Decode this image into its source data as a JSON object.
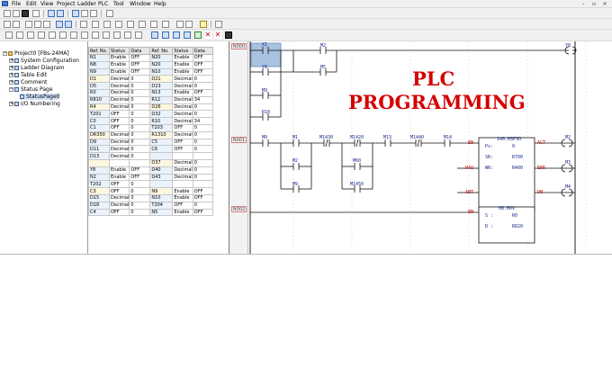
{
  "menu": {
    "items": [
      "File",
      "Edit",
      "View",
      "Project",
      "Ladder",
      "PLC",
      "Tool",
      "Window",
      "Help"
    ],
    "window_buttons": [
      "–",
      "▫",
      "×"
    ]
  },
  "tree": {
    "items": [
      {
        "label": "Project0 [FBs-24MA]",
        "level": 0,
        "expander": "−"
      },
      {
        "label": "System Configuration",
        "level": 1,
        "expander": "+"
      },
      {
        "label": "Ladder Diagram",
        "level": 1,
        "expander": "+"
      },
      {
        "label": "Table Edit",
        "level": 1,
        "expander": "+"
      },
      {
        "label": "Comment",
        "level": 1,
        "expander": "+"
      },
      {
        "label": "Status Page",
        "level": 1,
        "expander": "−"
      },
      {
        "label": "StatusPage0",
        "level": 2,
        "expander": ""
      },
      {
        "label": "I/O Numbering",
        "level": 1,
        "expander": "+"
      }
    ]
  },
  "status_table": {
    "headers": [
      "Ref. No.",
      "Status",
      "Data",
      "Ref. No.",
      "Status",
      "Data"
    ],
    "rows": [
      [
        "N1",
        "Enable",
        "OFF",
        "N20",
        "Enable",
        "OFF"
      ],
      [
        "N8",
        "Enable",
        "OFF",
        "N20",
        "Enable",
        "OFF"
      ],
      [
        "N9",
        "Enable",
        "OFF",
        "N10",
        "Enable",
        "OFF"
      ],
      [
        "D1",
        "Decimal",
        "0",
        "D21",
        "Decimal",
        "0"
      ],
      [
        "D5",
        "Decimal",
        "0",
        "D23",
        "Decimal",
        "0"
      ],
      [
        "R0",
        "Decimal",
        "0",
        "N13",
        "Enable",
        "OFF"
      ],
      [
        "R810",
        "Decimal",
        "0",
        "R12",
        "Decimal",
        "34"
      ],
      [
        "R4",
        "Decimal",
        "0",
        "D26",
        "Decimal",
        "0"
      ],
      [
        "T201",
        "OFF",
        "0",
        "D32",
        "Decimal",
        "0"
      ],
      [
        "C0",
        "OFF",
        "0",
        "R10",
        "Decimal",
        "34"
      ],
      [
        "C1",
        "OFF",
        "0",
        "T203",
        "OFF",
        "0"
      ],
      [
        "DR350",
        "Decimal",
        "0",
        "R1310",
        "Decimal",
        "0"
      ],
      [
        "D9",
        "Decimal",
        "0",
        "C5",
        "OFF",
        "0"
      ],
      [
        "D11",
        "Decimal",
        "0",
        "C6",
        "OFF",
        "0"
      ],
      [
        "D13",
        "Decimal",
        "0",
        "",
        "",
        ""
      ],
      [
        "",
        "",
        "",
        "D37",
        "Decimal",
        "0"
      ],
      [
        "Y8",
        "Enable",
        "OFF",
        "D40",
        "Decimal",
        "0"
      ],
      [
        "N2",
        "Enable",
        "OFF",
        "D43",
        "Decimal",
        "0"
      ],
      [
        "T202",
        "OFF",
        "0",
        "",
        "",
        ""
      ],
      [
        "C3",
        "OFF",
        "0",
        "N9",
        "Enable",
        "OFF"
      ],
      [
        "D15",
        "Decimal",
        "0",
        "N10",
        "Enable",
        "OFF"
      ],
      [
        "D18",
        "Decimal",
        "0",
        "T204",
        "OFF",
        "0"
      ],
      [
        "C4",
        "OFF",
        "0",
        "N5",
        "Enable",
        "OFF"
      ]
    ]
  },
  "ladder": {
    "overlay_title_line1": "PLC",
    "overlay_title_line2": "PROGRAMMING",
    "rung_labels": [
      "N000",
      "N001",
      "N002"
    ],
    "rung0": {
      "contacts": [
        "X1",
        "M2",
        "Y8",
        "M5",
        "M9",
        "R10"
      ],
      "coil": "Y8"
    },
    "rung1": {
      "contacts": [
        "M0",
        "M1",
        "M1430",
        "M1420",
        "M13",
        "M1440",
        "M14",
        "M2",
        "M60",
        "M9",
        "M1450"
      ],
      "function_block": {
        "title": "140.HSPSO",
        "rows": [
          [
            "Ps:",
            "0"
          ],
          [
            "SR:",
            "R700"
          ],
          [
            "WR:",
            "R400"
          ]
        ]
      },
      "inputs": [
        "EN",
        "PAU",
        "ABT"
      ],
      "outputs": [
        {
          "pin": "ACT",
          "coil": "M2"
        },
        {
          "pin": "ERR",
          "coil": "M3"
        },
        {
          "pin": "DN",
          "coil": "M4"
        }
      ]
    },
    "rung2": {
      "function_block": {
        "title": "08.MOV",
        "rows": [
          [
            "S :",
            "R0"
          ],
          [
            "D :",
            "R820"
          ]
        ]
      },
      "inputs": [
        "EN"
      ]
    }
  }
}
